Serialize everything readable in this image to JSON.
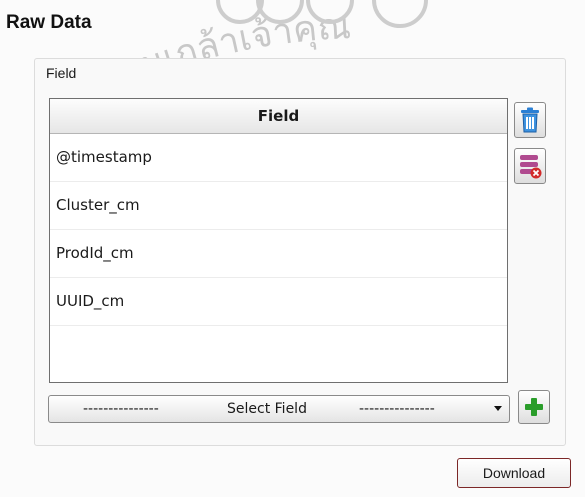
{
  "section": {
    "title": "Raw Data"
  },
  "group": {
    "label": "Field"
  },
  "table": {
    "header": "Field",
    "rows": [
      "@timestamp",
      "Cluster_cm",
      "ProdId_cm",
      "UUID_cm"
    ]
  },
  "select": {
    "left_dashes": "---------------",
    "label": "Select Field",
    "right_dashes": "---------------"
  },
  "actions": {
    "download_label": "Download"
  },
  "watermark": {
    "text": "ระจอมเกล้าเจ้าคุณ"
  },
  "icons": {
    "delete": "trash-icon",
    "remove_all": "stack-remove-icon",
    "add": "plus-icon",
    "dropdown": "chevron-down-icon"
  },
  "colors": {
    "add_green": "#2a9d2a",
    "trash_blue": "#2a7fd4",
    "remove_pink": "#b04a8f",
    "remove_red": "#d22a2a"
  }
}
